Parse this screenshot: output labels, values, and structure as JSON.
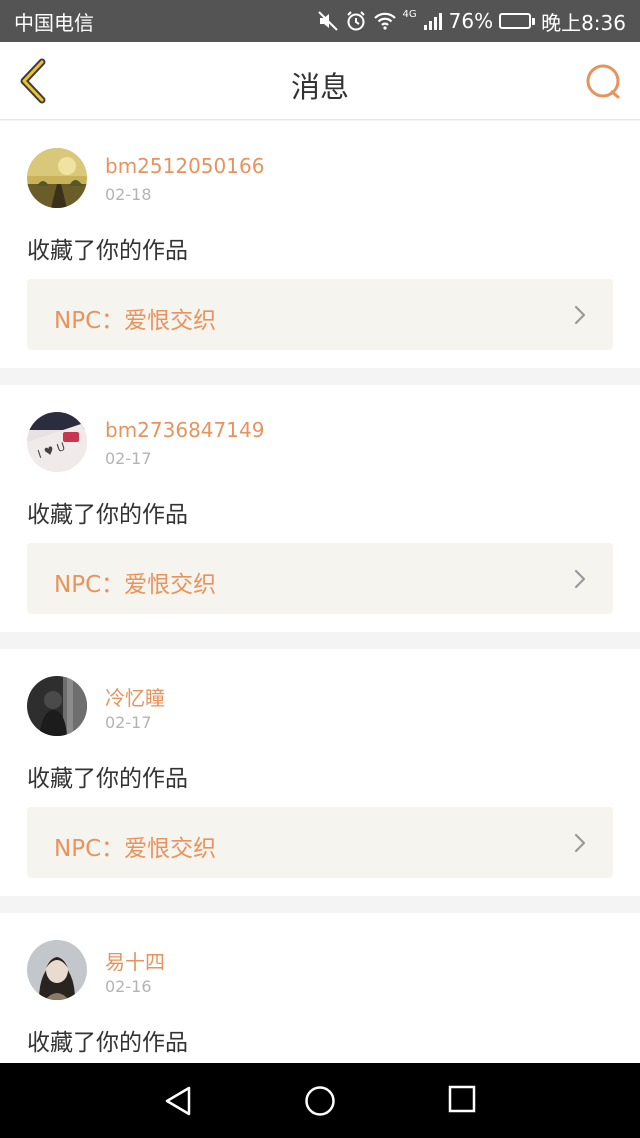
{
  "status_bar": {
    "carrier": "中国电信",
    "network": "4G",
    "battery": "76%",
    "battery_level": 0.76,
    "time": "晚上8:36"
  },
  "header": {
    "title": "消息"
  },
  "messages": [
    {
      "username": "bm2512050166",
      "date": "02-18",
      "action": "收藏了你的作品",
      "work_title": "NPC：爱恨交织"
    },
    {
      "username": "bm2736847149",
      "date": "02-17",
      "action": "收藏了你的作品",
      "work_title": "NPC：爱恨交织"
    },
    {
      "username": "冷忆瞳",
      "date": "02-17",
      "action": "收藏了你的作品",
      "work_title": "NPC：爱恨交织"
    },
    {
      "username": "易十四",
      "date": "02-16",
      "action": "收藏了你的作品"
    }
  ],
  "colors": {
    "accent": "#e8935d",
    "status_bar": "#545454",
    "work_link_bg": "#f5f4ee"
  }
}
